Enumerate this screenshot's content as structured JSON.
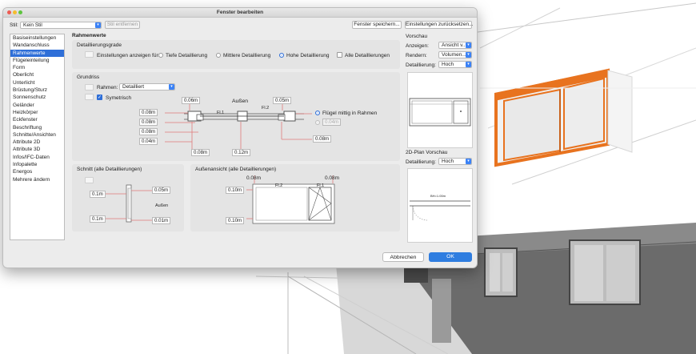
{
  "window": {
    "title": "Fenster bearbeiten"
  },
  "toolbar": {
    "style_label": "Stil:",
    "style_value": "Kein Stil",
    "remove_style": "Stil entfernen",
    "save_window": "Fenster speichern...",
    "reset_settings": "Einstellungen zurücksetzen..."
  },
  "sidebar": {
    "items": [
      "Basiseinstellungen",
      "Wandanschluss",
      "Rahmenwerte",
      "Flügeleinteilung",
      "Form",
      "Oberlicht",
      "Unterlicht",
      "Brüstung/Sturz",
      "Sonnenschutz",
      "Geländer",
      "Heizkörper",
      "Eckfenster",
      "Beschriftung",
      "Schnitte/Ansichten",
      "Attribute 2D",
      "Attribute 3D",
      "Infos/IFC-Daten",
      "Infopalette",
      "Energos",
      "Mehrere ändern"
    ],
    "active": "Rahmenwerte"
  },
  "content": {
    "heading": "Rahmenwerte",
    "detail_levels": {
      "title": "Detaillierungsgrade",
      "show_settings_for": "Einstellungen anzeigen für:",
      "options": [
        "Tiefe Detaillierung",
        "Mittlere Detaillierung",
        "Hohe Detaillierung"
      ],
      "selected": "Hohe Detaillierung",
      "all_levels": "Alle Detaillierungen"
    },
    "plan": {
      "title": "Grundriss",
      "frame_label": "Rahmen:",
      "frame_value": "Detailliert",
      "symmetric": "Symetrisch",
      "outside": "Außen",
      "fl1": "Fl.1",
      "fl2": "Fl.2",
      "wing_center": "Flügel mittig in Rahmen",
      "dims": {
        "top_left": "0.06m",
        "top_right": "0.05m",
        "l1": "0.08m",
        "l2": "0.08m",
        "l3": "0.08m",
        "l4": "0.04m",
        "bottom_a": "0.08m",
        "bottom_b": "0.12m",
        "right_a": "0.04m",
        "right_b": "0.08m"
      }
    },
    "section": {
      "title": "Schnitt (alle Detaillierungen)",
      "left_top": "0.1m",
      "left_bottom": "0.1m",
      "right_top": "0.05m",
      "right_bottom": "0.01m",
      "outside": "Außen"
    },
    "elevation": {
      "title": "Außenansicht (alle Detaillierungen)",
      "top_a": "0.08m",
      "top_b": "0.08m",
      "left_top": "0.10m",
      "left_bottom": "0.10m",
      "fl2": "Fl.2",
      "fl1": "Fl.1"
    }
  },
  "preview": {
    "title": "Vorschau",
    "show_label": "Anzeigen:",
    "show_value": "Ansicht v...",
    "render_label": "Rendern:",
    "render_value": "Volumen...",
    "detail_label": "Detaillierung:",
    "detail_value": "Hoch",
    "plan_title": "2D-Plan Vorschau",
    "plan_detail_label": "Detaillierung:",
    "plan_detail_value": "Hoch",
    "plan_dim": "BH=1.00m"
  },
  "footer": {
    "cancel": "Abbrechen",
    "ok": "OK"
  },
  "colors": {
    "accent": "#2f6fd8",
    "frame_orange": "#e8731f",
    "wall_gray": "#6b6b6b"
  }
}
